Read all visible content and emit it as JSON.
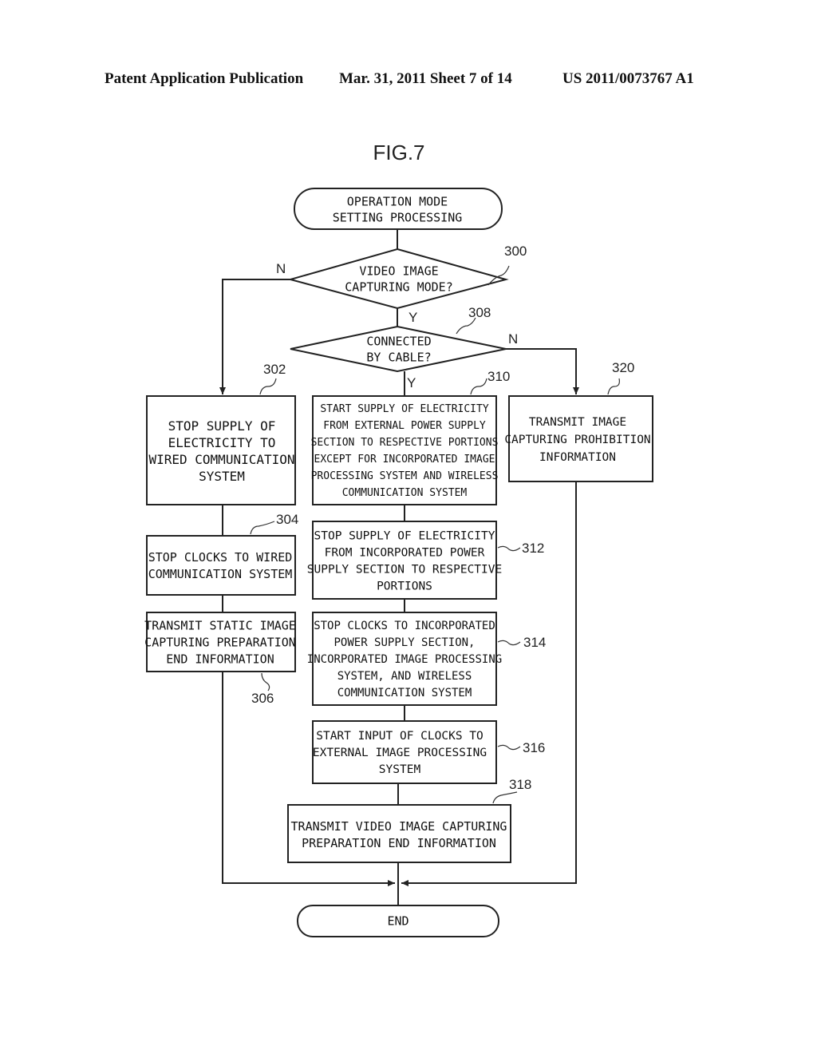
{
  "header": {
    "publication": "Patent Application Publication",
    "date_sheet": "Mar. 31, 2011  Sheet 7 of 14",
    "patent_number": "US 2011/0073767 A1"
  },
  "figure": {
    "title": "FIG.7",
    "nodes": {
      "start": {
        "lines": [
          "OPERATION MODE",
          "SETTING PROCESSING"
        ]
      },
      "d300": {
        "ref": "300",
        "lines": [
          "VIDEO IMAGE",
          "CAPTURING MODE?"
        ]
      },
      "d308": {
        "ref": "308",
        "lines": [
          "CONNECTED",
          "BY CABLE?"
        ]
      },
      "b302": {
        "ref": "302",
        "lines": [
          "STOP SUPPLY OF",
          "ELECTRICITY TO",
          "WIRED COMMUNICATION",
          "SYSTEM"
        ]
      },
      "b304": {
        "ref": "304",
        "lines": [
          "STOP CLOCKS TO WIRED",
          "COMMUNICATION SYSTEM"
        ]
      },
      "b306": {
        "ref": "306",
        "lines": [
          "TRANSMIT STATIC IMAGE",
          "CAPTURING PREPARATION",
          "END INFORMATION"
        ]
      },
      "b310": {
        "ref": "310",
        "lines": [
          "START SUPPLY OF ELECTRICITY",
          "FROM EXTERNAL POWER SUPPLY",
          "SECTION TO RESPECTIVE PORTIONS",
          "EXCEPT FOR INCORPORATED IMAGE",
          "PROCESSING SYSTEM AND WIRELESS",
          "COMMUNICATION SYSTEM"
        ]
      },
      "b312": {
        "ref": "312",
        "lines": [
          "STOP SUPPLY OF ELECTRICITY",
          "FROM INCORPORATED POWER",
          "SUPPLY SECTION TO RESPECTIVE",
          "PORTIONS"
        ]
      },
      "b314": {
        "ref": "314",
        "lines": [
          "STOP CLOCKS TO INCORPORATED",
          "POWER SUPPLY SECTION,",
          "INCORPORATED IMAGE PROCESSING",
          "SYSTEM, AND WIRELESS",
          "COMMUNICATION SYSTEM"
        ]
      },
      "b316": {
        "ref": "316",
        "lines": [
          "START INPUT OF CLOCKS TO",
          "EXTERNAL IMAGE PROCESSING",
          "SYSTEM"
        ]
      },
      "b318": {
        "ref": "318",
        "lines": [
          "TRANSMIT VIDEO IMAGE CAPTURING",
          "PREPARATION END INFORMATION"
        ]
      },
      "b320": {
        "ref": "320",
        "lines": [
          "TRANSMIT IMAGE",
          "CAPTURING PROHIBITION",
          "INFORMATION"
        ]
      },
      "end": {
        "lines": [
          "END"
        ]
      }
    },
    "branch_labels": {
      "d300_no": "N",
      "d300_yes": "Y",
      "d308_no": "N",
      "d308_yes": "Y"
    }
  }
}
